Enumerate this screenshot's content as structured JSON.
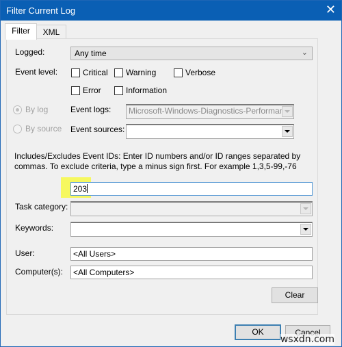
{
  "window": {
    "title": "Filter Current Log",
    "close_icon": "close-icon"
  },
  "tabs": [
    {
      "label": "Filter",
      "active": true
    },
    {
      "label": "XML",
      "active": false
    }
  ],
  "filter": {
    "logged": {
      "label": "Logged:",
      "value": "Any time"
    },
    "event_level": {
      "label": "Event level:",
      "options": [
        {
          "label": "Critical",
          "checked": false
        },
        {
          "label": "Warning",
          "checked": false
        },
        {
          "label": "Verbose",
          "checked": false
        },
        {
          "label": "Error",
          "checked": false
        },
        {
          "label": "Information",
          "checked": false
        }
      ]
    },
    "by_log": {
      "label": "By log",
      "selected": true,
      "enabled": false
    },
    "by_source": {
      "label": "By source",
      "selected": false,
      "enabled": false
    },
    "event_logs": {
      "label": "Event logs:",
      "value": "Microsoft-Windows-Diagnostics-Performance"
    },
    "event_sources": {
      "label": "Event sources:",
      "value": ""
    },
    "event_ids": {
      "description": "Includes/Excludes Event IDs: Enter ID numbers and/or ID ranges separated by commas. To exclude criteria, type a minus sign first. For example 1,3,5-99,-76",
      "value": "203"
    },
    "task_category": {
      "label": "Task category:",
      "value": ""
    },
    "keywords": {
      "label": "Keywords:",
      "value": ""
    },
    "user": {
      "label": "User:",
      "value": "<All Users>"
    },
    "computers": {
      "label": "Computer(s):",
      "value": "<All Computers>"
    },
    "clear_label": "Clear"
  },
  "footer": {
    "ok_label": "OK",
    "cancel_label": "Cancel"
  },
  "watermark": "wsxdn.com",
  "colors": {
    "titlebar": "#0a5fb4",
    "highlight": "#f6f85f",
    "default_button_border": "#3c7fb1"
  }
}
